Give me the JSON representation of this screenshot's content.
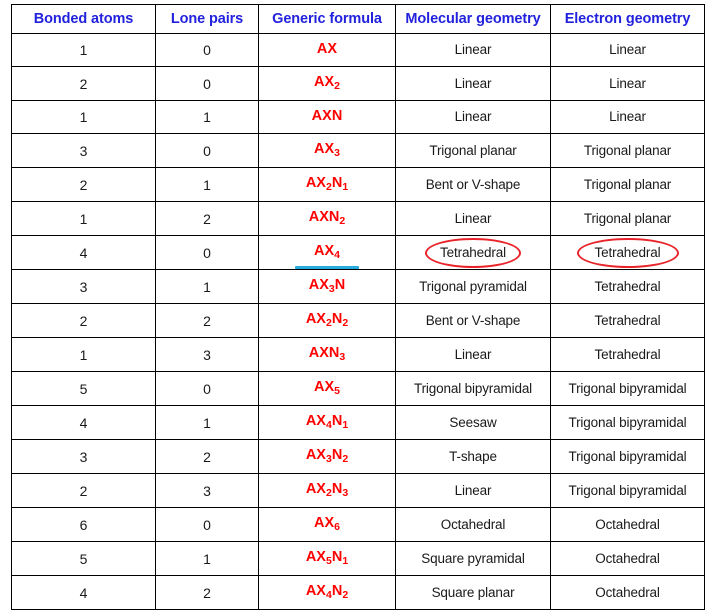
{
  "table": {
    "columns": [
      {
        "key": "bonded_atoms",
        "label": "Bonded atoms"
      },
      {
        "key": "lone_pairs",
        "label": "Lone pairs"
      },
      {
        "key": "generic_formula",
        "label": "Generic formula"
      },
      {
        "key": "molecular_geometry",
        "label": "Molecular geometry"
      },
      {
        "key": "electron_geometry",
        "label": "Electron geometry"
      }
    ],
    "rows": [
      {
        "bonded_atoms": "1",
        "lone_pairs": "0",
        "formula_base": "AX",
        "formula_sub1": "",
        "formula_n": "",
        "formula_sub2": "",
        "formula_plain": "AX",
        "molecular_geometry": "Linear",
        "electron_geometry": "Linear"
      },
      {
        "bonded_atoms": "2",
        "lone_pairs": "0",
        "formula_base": "AX",
        "formula_sub1": "2",
        "formula_n": "",
        "formula_sub2": "",
        "formula_plain": "AX2",
        "molecular_geometry": "Linear",
        "electron_geometry": "Linear"
      },
      {
        "bonded_atoms": "1",
        "lone_pairs": "1",
        "formula_base": "AX",
        "formula_sub1": "",
        "formula_n": "N",
        "formula_sub2": "",
        "formula_plain": "AXN",
        "molecular_geometry": "Linear",
        "electron_geometry": "Linear"
      },
      {
        "bonded_atoms": "3",
        "lone_pairs": "0",
        "formula_base": "AX",
        "formula_sub1": "3",
        "formula_n": "",
        "formula_sub2": "",
        "formula_plain": "AX3",
        "molecular_geometry": "Trigonal planar",
        "electron_geometry": "Trigonal planar"
      },
      {
        "bonded_atoms": "2",
        "lone_pairs": "1",
        "formula_base": "AX",
        "formula_sub1": "2",
        "formula_n": "N",
        "formula_sub2": "1",
        "formula_plain": "AX2N1",
        "molecular_geometry": "Bent or V-shape",
        "electron_geometry": "Trigonal planar"
      },
      {
        "bonded_atoms": "1",
        "lone_pairs": "2",
        "formula_base": "AX",
        "formula_sub1": "",
        "formula_n": "N",
        "formula_sub2": "2",
        "formula_plain": "AXN2",
        "molecular_geometry": "Linear",
        "electron_geometry": "Trigonal planar"
      },
      {
        "bonded_atoms": "4",
        "lone_pairs": "0",
        "formula_base": "AX",
        "formula_sub1": "4",
        "formula_n": "",
        "formula_sub2": "",
        "formula_plain": "AX4",
        "molecular_geometry": "Tetrahedral",
        "electron_geometry": "Tetrahedral"
      },
      {
        "bonded_atoms": "3",
        "lone_pairs": "1",
        "formula_base": "AX",
        "formula_sub1": "3",
        "formula_n": "N",
        "formula_sub2": "",
        "formula_plain": "AX3N",
        "molecular_geometry": "Trigonal pyramidal",
        "electron_geometry": "Tetrahedral"
      },
      {
        "bonded_atoms": "2",
        "lone_pairs": "2",
        "formula_base": "AX",
        "formula_sub1": "2",
        "formula_n": "N",
        "formula_sub2": "2",
        "formula_plain": "AX2N2",
        "molecular_geometry": "Bent or V-shape",
        "electron_geometry": "Tetrahedral"
      },
      {
        "bonded_atoms": "1",
        "lone_pairs": "3",
        "formula_base": "AX",
        "formula_sub1": "",
        "formula_n": "N",
        "formula_sub2": "3",
        "formula_plain": "AXN3",
        "molecular_geometry": "Linear",
        "electron_geometry": "Tetrahedral"
      },
      {
        "bonded_atoms": "5",
        "lone_pairs": "0",
        "formula_base": "AX",
        "formula_sub1": "5",
        "formula_n": "",
        "formula_sub2": "",
        "formula_plain": "AX5",
        "molecular_geometry": "Trigonal bipyramidal",
        "electron_geometry": "Trigonal bipyramidal"
      },
      {
        "bonded_atoms": "4",
        "lone_pairs": "1",
        "formula_base": "AX",
        "formula_sub1": "4",
        "formula_n": "N",
        "formula_sub2": "1",
        "formula_plain": "AX4N1",
        "molecular_geometry": "Seesaw",
        "electron_geometry": "Trigonal bipyramidal"
      },
      {
        "bonded_atoms": "3",
        "lone_pairs": "2",
        "formula_base": "AX",
        "formula_sub1": "3",
        "formula_n": "N",
        "formula_sub2": "2",
        "formula_plain": "AX3N2",
        "molecular_geometry": "T-shape",
        "electron_geometry": "Trigonal bipyramidal"
      },
      {
        "bonded_atoms": "2",
        "lone_pairs": "3",
        "formula_base": "AX",
        "formula_sub1": "2",
        "formula_n": "N",
        "formula_sub2": "3",
        "formula_plain": "AX2N3",
        "molecular_geometry": "Linear",
        "electron_geometry": "Trigonal bipyramidal"
      },
      {
        "bonded_atoms": "6",
        "lone_pairs": "0",
        "formula_base": "AX",
        "formula_sub1": "6",
        "formula_n": "",
        "formula_sub2": "",
        "formula_plain": "AX6",
        "molecular_geometry": "Octahedral",
        "electron_geometry": "Octahedral"
      },
      {
        "bonded_atoms": "5",
        "lone_pairs": "1",
        "formula_base": "AX",
        "formula_sub1": "5",
        "formula_n": "N",
        "formula_sub2": "1",
        "formula_plain": "AX5N1",
        "molecular_geometry": "Square pyramidal",
        "electron_geometry": "Octahedral"
      },
      {
        "bonded_atoms": "4",
        "lone_pairs": "2",
        "formula_base": "AX",
        "formula_sub1": "4",
        "formula_n": "N",
        "formula_sub2": "2",
        "formula_plain": "AX4N2",
        "molecular_geometry": "Square planar",
        "electron_geometry": "Octahedral"
      }
    ]
  },
  "annotations": {
    "underline": {
      "row_index": 6,
      "target": "AX4",
      "color": "#29abe2"
    },
    "ellipses": [
      {
        "row_index": 6,
        "column": "molecular_geometry",
        "target": "Tetrahedral",
        "color": "#e8242a"
      },
      {
        "row_index": 6,
        "column": "electron_geometry",
        "target": "Tetrahedral",
        "color": "#e8242a"
      }
    ]
  },
  "colors": {
    "header_text": "#2222dd",
    "formula_text": "#ff0000",
    "body_text": "#1a1a1a",
    "border": "#000000",
    "background": "#ffffff",
    "highlight_underline": "#29abe2",
    "highlight_circle": "#e8242a"
  }
}
